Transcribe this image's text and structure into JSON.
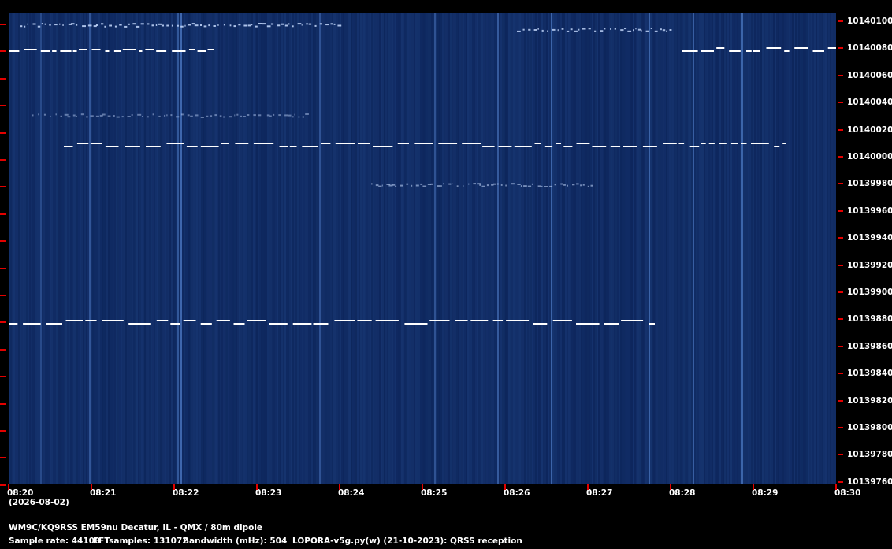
{
  "frequency_labels": [
    "10140100",
    "10140080",
    "10140060",
    "10140040",
    "10140020",
    "10140000",
    "10139980",
    "10139960",
    "10139940",
    "10139920",
    "10139900",
    "10139880",
    "10139860",
    "10139840",
    "10139820",
    "10139800",
    "10139780",
    "10139760"
  ],
  "time_labels": [
    "08:20",
    "08:21",
    "08:22",
    "08:23",
    "08:24",
    "08:25",
    "08:26",
    "08:27",
    "08:28",
    "08:29",
    "08:30"
  ],
  "date_label": "(2026-08-02)",
  "station_line": "WM9C/KQ9RSS EM59nu Decatur, IL - QMX / 80m dipole",
  "sample_rate": "Sample rate: 44100",
  "fft_samples": "FFTsamples: 131072",
  "bandwidth": "Bandwidth (mHz): 504",
  "software": "LOPORA-v5g.py(w) (21-10-2023): QRSS reception",
  "colors": {
    "background": "#0b2358",
    "signal": "#ffffff",
    "tick": "#e30000"
  }
}
